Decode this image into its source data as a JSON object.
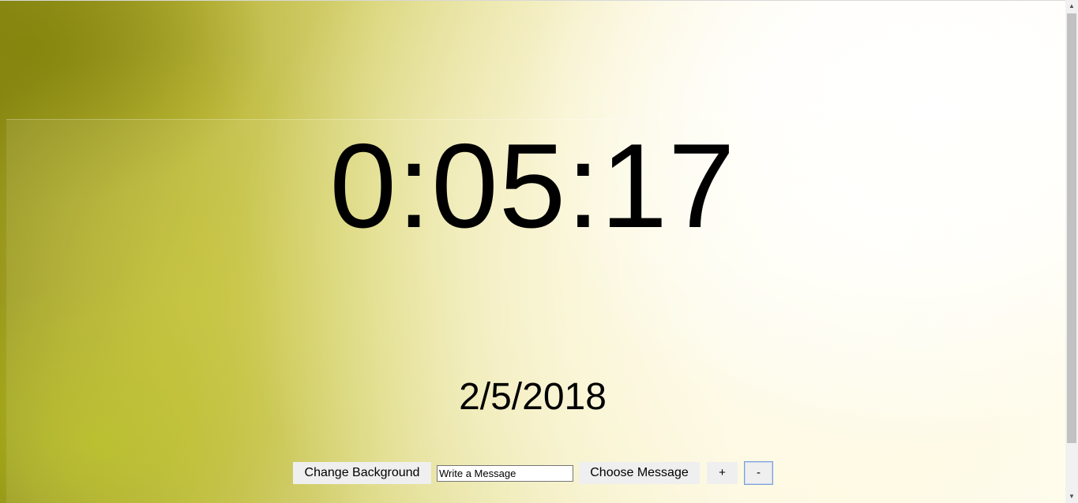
{
  "timer": {
    "display": "0:05:17"
  },
  "date": {
    "display": "2/5/2018"
  },
  "controls": {
    "change_background_label": "Change Background",
    "message_placeholder": "Write a Message",
    "message_value": "",
    "choose_message_label": "Choose Message",
    "plus_label": "+",
    "minus_label": "-"
  },
  "scrollbar": {
    "up_icon": "triangle-up-icon",
    "down_icon": "triangle-down-icon",
    "up_glyph": "▲",
    "down_glyph": "▼"
  },
  "colors": {
    "text": "#000000",
    "button_bg": "#efefef",
    "focus_border": "#7a9fd6"
  }
}
